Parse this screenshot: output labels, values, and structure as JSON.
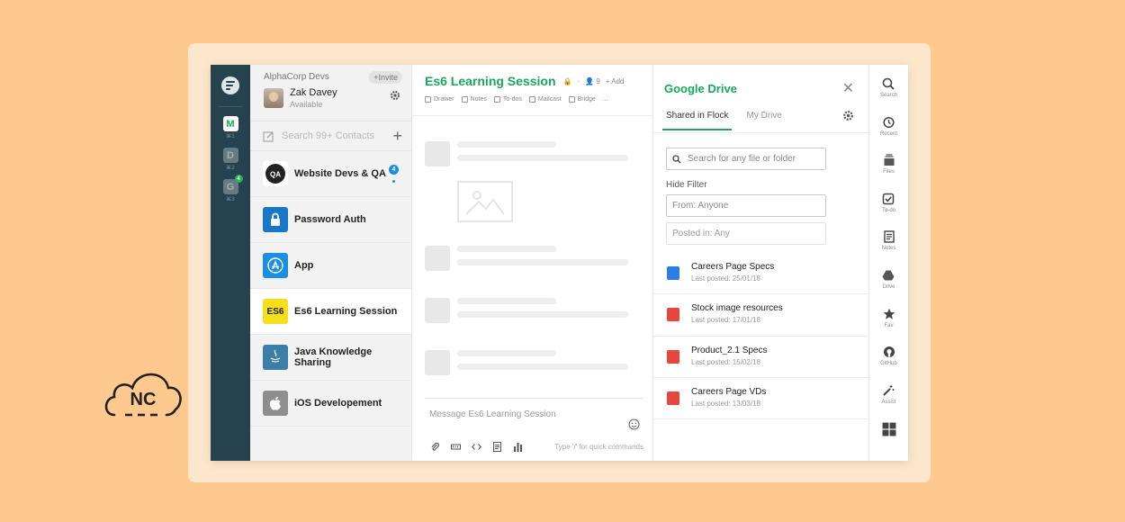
{
  "brand_logo": {
    "text": "NC"
  },
  "colors": {
    "background": "#fdc98f",
    "accent": "#19a85a",
    "rail": "#26424e",
    "badge": "#1d8fe1"
  },
  "workspaces": [
    {
      "letter": "M",
      "key": "⌘1",
      "active": true
    },
    {
      "letter": "D",
      "key": "⌘2",
      "active": false
    },
    {
      "letter": "G",
      "key": "⌘3",
      "active": false,
      "badge": "4"
    }
  ],
  "team": {
    "name": "AlphaCorp Devs",
    "invite_label": "+Invite"
  },
  "user": {
    "name": "Zak Davey",
    "status": "Available"
  },
  "contacts_search": {
    "placeholder": "Search 99+ Contacts"
  },
  "chats": [
    {
      "name": "Website Devs & QA",
      "icon": "QA",
      "badge": "4"
    },
    {
      "name": "Password Auth",
      "icon": "lock-icon"
    },
    {
      "name": "App",
      "icon": "app-store-icon"
    },
    {
      "name": "Es6 Learning Session",
      "icon": "ES6",
      "selected": true
    },
    {
      "name": "Java Knowledge Sharing",
      "icon": "java-icon"
    },
    {
      "name": "iOS Developement",
      "icon": "apple-icon"
    }
  ],
  "channel": {
    "title": "Es6 Learning Session",
    "members": "9",
    "add_label": "+ Add",
    "tools": [
      "Drawer",
      "Notes",
      "To-dos",
      "Mailcast",
      "Bridge",
      "..."
    ]
  },
  "composer": {
    "placeholder": "Message Es6 Learning Session",
    "hint": "Type '/' for quick commands"
  },
  "drive": {
    "title": "Google Drive",
    "tabs": [
      "Shared in Flock",
      "My Drive"
    ],
    "search_placeholder": "Search for any file or folder",
    "hide_filter_label": "Hide Filter",
    "from_placeholder": "From: Anyone",
    "posted_placeholder": "Posted in: Any",
    "files": [
      {
        "name": "Careers Page Specs",
        "date": "Last posted: 25/01/18",
        "type": "doc"
      },
      {
        "name": "Stock image resources",
        "date": "Last posted: 17/01/18",
        "type": "image"
      },
      {
        "name": "Product_2.1 Specs",
        "date": "Last posted: 15/02/18",
        "type": "pdf"
      },
      {
        "name": "Careers Page VDs",
        "date": "Last posted: 13/03/18",
        "type": "image"
      }
    ]
  },
  "right_tools": [
    "Search",
    "Recent",
    "Files",
    "To-do",
    "Notes",
    "Drive",
    "Fav",
    "GitHub",
    "Assist"
  ]
}
